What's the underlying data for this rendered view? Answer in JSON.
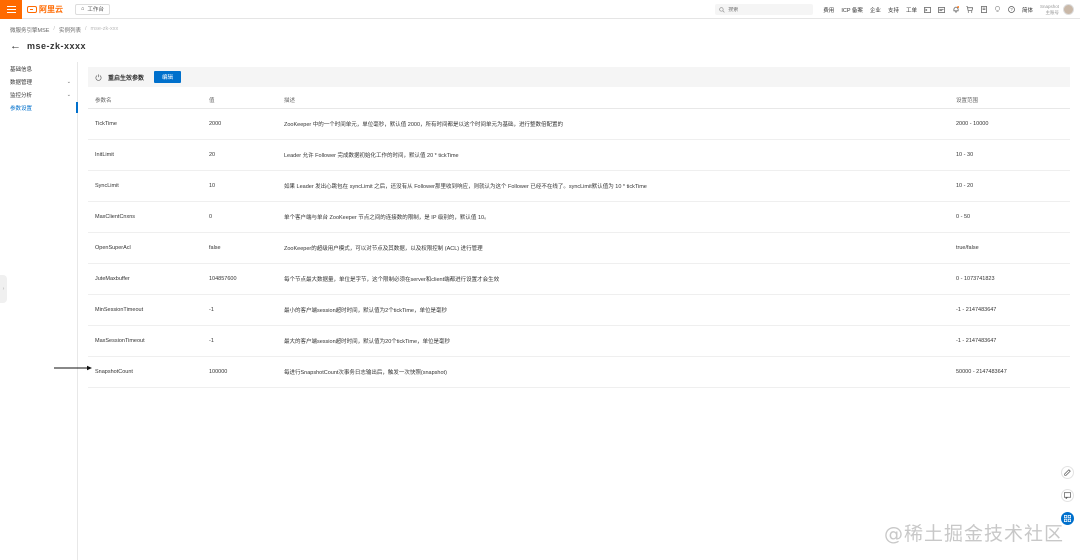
{
  "topbar": {
    "brand": "阿里云",
    "workbench_label": "工作台",
    "search_placeholder": "搜索",
    "links": [
      "费用",
      "ICP 备案",
      "企业",
      "支持",
      "工单"
    ],
    "lang": "简体",
    "account_line1": "Snapshot",
    "account_line2": "主账号"
  },
  "breadcrumb": [
    "微服务引擎MSE",
    "实例列表",
    "mse-zk-xxx"
  ],
  "page_title": "mse-zk-xxxx",
  "sidebar": {
    "items": [
      {
        "label": "基础信息",
        "has_chevron": false
      },
      {
        "label": "数据管理",
        "has_chevron": true
      },
      {
        "label": "监控分析",
        "has_chevron": true
      },
      {
        "label": "参数设置",
        "has_chevron": false
      }
    ]
  },
  "card": {
    "title": "重启生效参数",
    "edit_label": "编辑"
  },
  "table": {
    "headers": [
      "参数名",
      "值",
      "描述",
      "设置范围"
    ],
    "rows": [
      [
        "TickTime",
        "2000",
        "ZooKeeper 中的一个时间单元，单位毫秒，默认值 2000，所有时间都是以这个时间单元为基础，进行整数倍配置的",
        "2000 - 10000"
      ],
      [
        "InitLimit",
        "20",
        "Leader 允许 Follower 完成数据初始化工作的时间，默认值 20 * tickTime",
        "10 - 30"
      ],
      [
        "SyncLimit",
        "10",
        "如果 Leader 发出心跳包在 syncLimit 之后，还没有从 Follower那里收到响应，则就认为这个 Follower 已经不在线了。syncLimit默认值为 10 * tickTime",
        "10 - 20"
      ],
      [
        "MaxClientCnxns",
        "0",
        "单个客户端与单台 ZooKeeper 节点之间的连接数的限制，是 IP 级别的，默认值 10。",
        "0 - 50"
      ],
      [
        "OpenSuperAcl",
        "false",
        "ZooKeeper的超级用户模式，可以对节点及其数据，以及权限控制 (ACL) 进行管理",
        "true/false"
      ],
      [
        "JuteMaxbuffer",
        "104857600",
        "每个节点最大数据量，单位是字节，这个限制必须在server和client端都进行设置才会生效",
        "0 - 1073741823"
      ],
      [
        "MinSessionTimeout",
        "-1",
        "最小的客户端session超时时间，默认值为2个tickTime，单位是毫秒",
        "-1 - 2147483647"
      ],
      [
        "MaxSessionTimeout",
        "-1",
        "最大的客户端session超时时间，默认值为20个tickTime，单位是毫秒",
        "-1 - 2147483647"
      ],
      [
        "SnapshotCount",
        "100000",
        "每进行SnapshotCount次事务日志输出后，触发一次快照(snapshot)",
        "50000 - 2147483647"
      ]
    ]
  },
  "watermark": "@稀土掘金技术社区",
  "colors": {
    "brand": "#ff6a00",
    "primary": "#0070cc"
  }
}
